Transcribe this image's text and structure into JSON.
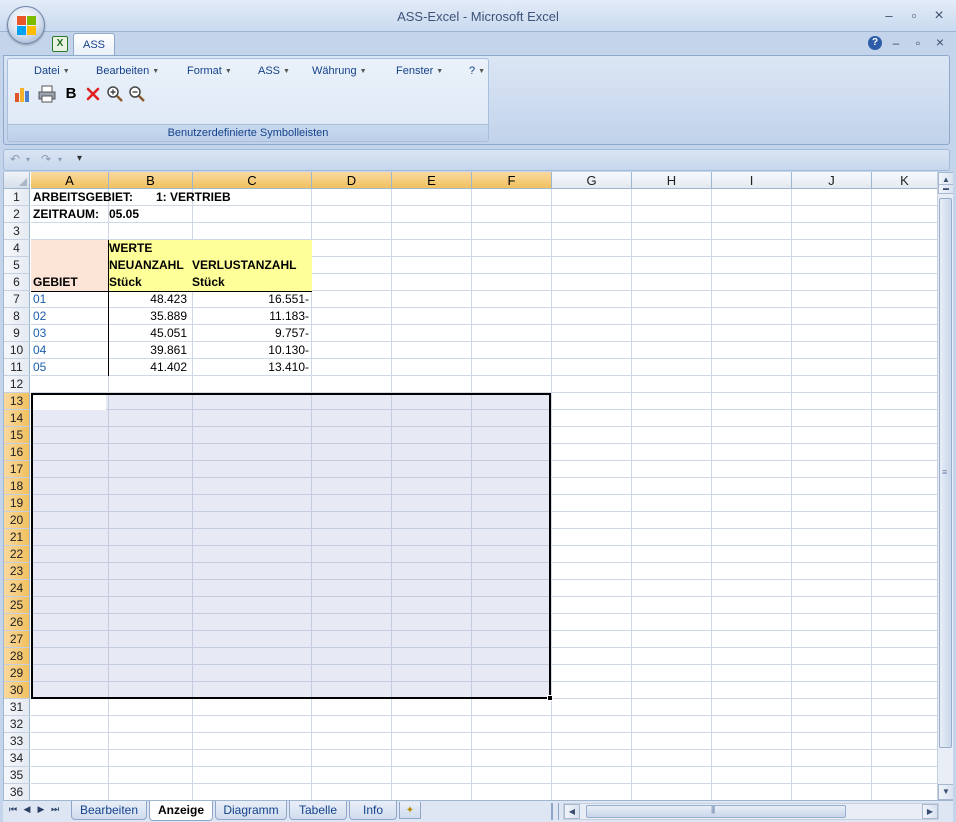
{
  "window": {
    "title": "ASS-Excel - Microsoft Excel",
    "minimize": "–",
    "maximize": "▫",
    "close": "×"
  },
  "ribbon": {
    "tab_label": "ASS",
    "group_label": "Benutzerdefinierte Symbolleisten",
    "menu": [
      "Datei",
      "Bearbeiten",
      "Format",
      "ASS",
      "Währung",
      "Fenster",
      "?"
    ],
    "toolbar_icons": [
      "chart-icon",
      "printer-icon",
      "bold-icon",
      "delete-icon",
      "zoom-in-icon",
      "zoom-out-icon"
    ],
    "bold_glyph": "B"
  },
  "qat": {
    "undo": "↶",
    "redo": "↷",
    "customize": "▾"
  },
  "help": "?",
  "grid": {
    "columns": [
      "A",
      "B",
      "C",
      "D",
      "E",
      "F",
      "G",
      "H",
      "I",
      "J",
      "K"
    ],
    "rows": [
      "1",
      "2",
      "3",
      "4",
      "5",
      "6",
      "7",
      "8",
      "9",
      "10",
      "11",
      "12",
      "13",
      "14",
      "15",
      "16",
      "17",
      "18",
      "19",
      "20",
      "21",
      "22",
      "23",
      "24",
      "25",
      "26",
      "27",
      "28",
      "29",
      "30",
      "31",
      "32",
      "33",
      "34",
      "35",
      "36"
    ],
    "selected_columns": [
      "A",
      "B",
      "C",
      "D",
      "E",
      "F"
    ],
    "selected_rows_from": 13,
    "selected_rows_to": 30
  },
  "cells": {
    "a1": "ARBEITSGEBIET:",
    "b1": "1: VERTRIEB",
    "a2": "ZEITRAUM:",
    "b2": "05.05",
    "b4": "WERTE",
    "b5": "NEUANZAHL",
    "c5": "VERLUSTANZAHL",
    "a6": "GEBIET",
    "b6": "Stück",
    "c6": "Stück"
  },
  "table_rows": [
    {
      "gebiet": "01",
      "neu": "48.423",
      "verlust": "16.551-"
    },
    {
      "gebiet": "02",
      "neu": "35.889",
      "verlust": "11.183-"
    },
    {
      "gebiet": "03",
      "neu": "45.051",
      "verlust": "9.757-"
    },
    {
      "gebiet": "04",
      "neu": "39.861",
      "verlust": "10.130-"
    },
    {
      "gebiet": "05",
      "neu": "41.402",
      "verlust": "13.410-"
    }
  ],
  "sheets": {
    "tabs": [
      "Bearbeiten",
      "Anzeige",
      "Diagramm",
      "Tabelle",
      "Info"
    ],
    "active": "Anzeige"
  },
  "colors": {
    "header_fill": "#ffff99",
    "gebiet_fill": "#fce4d6",
    "gebiet_text": "#1b5fae",
    "selected_header": "#f1c15f"
  }
}
